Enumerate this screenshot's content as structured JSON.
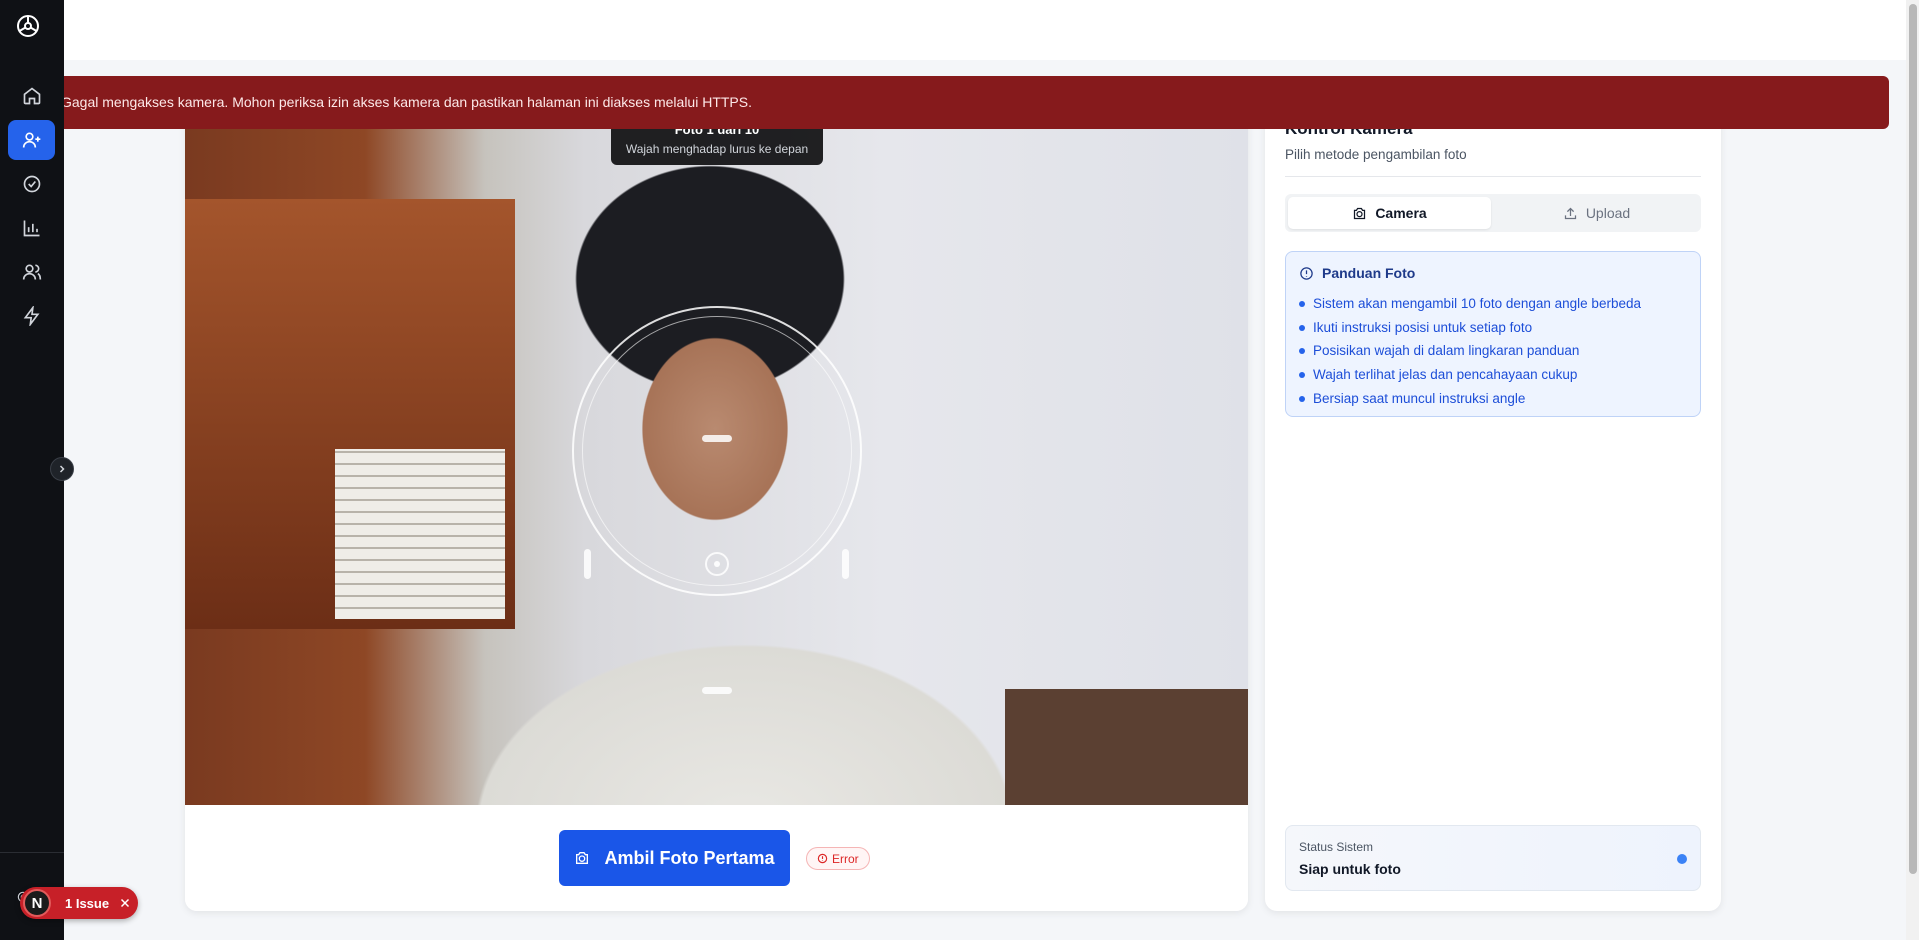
{
  "error_banner": {
    "message": "Gagal mengakses kamera. Mohon periksa izin akses kamera dan pastikan halaman ini diakses melalui HTTPS."
  },
  "camera": {
    "tooltip_title": "Foto 1 dari 10",
    "tooltip_subtitle": "Wajah menghadap lurus ke depan",
    "capture_button_label": "Ambil Foto Pertama",
    "status_badge": "Error"
  },
  "control_panel": {
    "title": "Kontrol Kamera",
    "subtitle": "Pilih metode pengambilan foto",
    "tabs": [
      {
        "label": "Camera",
        "icon": "camera-icon",
        "active": true
      },
      {
        "label": "Upload",
        "icon": "upload-icon",
        "active": false
      }
    ],
    "guide": {
      "title": "Panduan Foto",
      "items": [
        "Sistem akan mengambil 10 foto dengan angle berbeda",
        "Ikuti instruksi posisi untuk setiap foto",
        "Posisikan wajah di dalam lingkaran panduan",
        "Wajah terlihat jelas dan pencahayaan cukup",
        "Bersiap saat muncul instruksi angle"
      ]
    },
    "status": {
      "label": "Status Sistem",
      "value": "Siap untuk foto"
    }
  },
  "sidebar": {
    "items": [
      {
        "icon": "home-icon",
        "active": false
      },
      {
        "icon": "user-plus-icon",
        "active": true
      },
      {
        "icon": "check-circle-icon",
        "active": false
      },
      {
        "icon": "bar-chart-icon",
        "active": false
      },
      {
        "icon": "users-icon",
        "active": false
      },
      {
        "icon": "zap-icon",
        "active": false
      }
    ]
  },
  "issues": {
    "avatar_letter": "N",
    "label": "1 Issue"
  },
  "colors": {
    "accent": "#2563eb",
    "error_banner": "#861a1c",
    "capture_button": "#1a56e8"
  }
}
